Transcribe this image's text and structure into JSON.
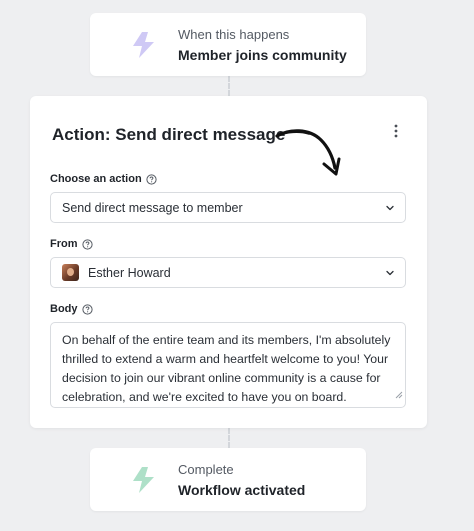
{
  "trigger": {
    "subtitle": "When this happens",
    "title": "Member joins community",
    "icon": "lightning-icon",
    "icon_color": "#c9c3f2"
  },
  "action": {
    "title": "Action: Send direct message",
    "menu_icon": "more-vertical-icon",
    "choose_action": {
      "label": "Choose an action",
      "value": "Send direct message to member"
    },
    "from": {
      "label": "From",
      "value": "Esther Howard"
    },
    "body": {
      "label": "Body",
      "value": "On behalf of the entire team and its members, I'm absolutely thrilled to extend a warm and heartfelt welcome to you! Your decision to join our vibrant online community is a cause for celebration, and we're excited to have you on board."
    }
  },
  "complete": {
    "subtitle": "Complete",
    "title": "Workflow activated",
    "icon": "lightning-icon",
    "icon_color": "#a8dcc3"
  }
}
